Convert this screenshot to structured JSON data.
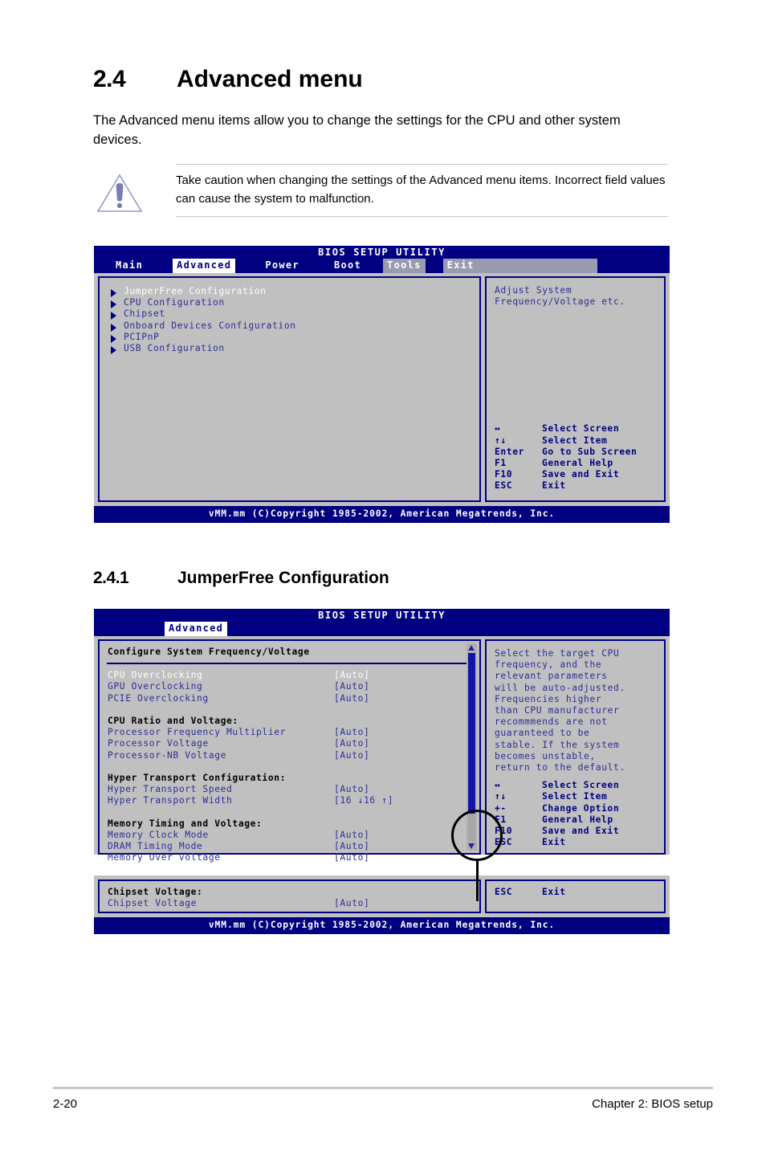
{
  "section_24": {
    "number": "2.4",
    "title": "Advanced menu",
    "paragraph": "The Advanced menu items allow you to change the settings for the CPU and other system devices."
  },
  "caution": {
    "icon": "warning-triangle-icon",
    "text": "Take caution when changing the settings of the Advanced menu items. Incorrect field values can cause the system to malfunction."
  },
  "bios_screen_1": {
    "title": "BIOS SETUP UTILITY",
    "menu": [
      {
        "label": "Main",
        "state": "normal"
      },
      {
        "label": "Advanced",
        "state": "active"
      },
      {
        "label": "Power",
        "state": "normal"
      },
      {
        "label": "Boot",
        "state": "normal"
      },
      {
        "label": "Tools",
        "state": "dim"
      },
      {
        "label": "Exit",
        "state": "dim"
      }
    ],
    "items": [
      "JumperFree Configuration",
      "CPU Configuration",
      "Chipset",
      "Onboard Devices Configuration",
      "PCIPnP",
      "USB Configuration"
    ],
    "help": "Adjust System\nFrequency/Voltage etc.",
    "keys": [
      {
        "key": "↔",
        "desc": "Select Screen"
      },
      {
        "key": "↑↓",
        "desc": "Select Item"
      },
      {
        "key": "Enter",
        "desc": "Go to Sub Screen"
      },
      {
        "key": "F1",
        "desc": "General Help"
      },
      {
        "key": "F10",
        "desc": "Save and Exit"
      },
      {
        "key": "ESC",
        "desc": "Exit"
      }
    ],
    "footer": "vMM.mm (C)Copyright 1985-2002, American Megatrends, Inc."
  },
  "section_241": {
    "number": "2.4.1",
    "title": "JumperFree Configuration"
  },
  "bios_screen_2": {
    "title": "BIOS SETUP UTILITY",
    "menu": [
      {
        "label": "Advanced",
        "state": "active"
      }
    ],
    "subhead": "Configure System Frequency/Voltage",
    "groups": [
      {
        "header": null,
        "rows": [
          {
            "label": "CPU Overclocking",
            "value": "[Auto]",
            "style": "white"
          },
          {
            "label": "GPU Overclocking",
            "value": "[Auto]",
            "style": "blue"
          },
          {
            "label": "PCIE Overclocking",
            "value": "[Auto]",
            "style": "blue"
          }
        ]
      },
      {
        "header": "CPU Ratio and Voltage:",
        "rows": [
          {
            "label": "Processor Frequency Multiplier",
            "value": "[Auto]",
            "style": "blue"
          },
          {
            "label": "Processor Voltage",
            "value": "[Auto]",
            "style": "blue"
          },
          {
            "label": "Processor-NB Voltage",
            "value": "[Auto]",
            "style": "blue"
          }
        ]
      },
      {
        "header": "Hyper Transport Configuration:",
        "rows": [
          {
            "label": "Hyper Transport Speed",
            "value": "[Auto]",
            "style": "blue"
          },
          {
            "label": "Hyper Transport Width",
            "value": "[16 ↓16 ↑]",
            "style": "blue"
          }
        ]
      },
      {
        "header": "Memory Timing and Voltage:",
        "rows": [
          {
            "label": "Memory Clock Mode",
            "value": "[Auto]",
            "style": "blue"
          },
          {
            "label": "DRAM Timing Mode",
            "value": "[Auto]",
            "style": "blue"
          },
          {
            "label": "Memory Over voltage",
            "value": "[Auto]",
            "style": "blue"
          }
        ]
      }
    ],
    "help": "Select the target CPU\nfrequency, and the\nrelevant parameters\nwill be auto-adjusted.\nFrequencies higher\nthan CPU manufacturer\nrecommmends are not\nguaranteed to be\nstable. If the system\nbecomes unstable,\nreturn to the default.",
    "keys": [
      {
        "key": "↔",
        "desc": "Select Screen"
      },
      {
        "key": "↑↓",
        "desc": "Select Item"
      },
      {
        "key": "+-",
        "desc": "Change Option"
      },
      {
        "key": "F1",
        "desc": "General Help"
      },
      {
        "key": "F10",
        "desc": "Save and Exit"
      },
      {
        "key": "ESC",
        "desc": "Exit"
      }
    ],
    "scrollbar": {
      "up_icon": "scroll-up-arrow-icon",
      "down_icon": "scroll-down-arrow-icon"
    },
    "lower_panel": {
      "header": "Chipset Voltage:",
      "rows": [
        {
          "label": "Chipset Voltage",
          "value": "[Auto]",
          "style": "blue"
        }
      ],
      "keys": [
        {
          "key": "ESC",
          "desc": "Exit"
        }
      ]
    },
    "footer": "vMM.mm (C)Copyright 1985-2002, American Megatrends, Inc."
  },
  "page_footer": {
    "left": "2-20",
    "right": "Chapter 2: BIOS setup"
  },
  "colors": {
    "bios_navy": "#000080",
    "bios_gray": "#c0c0c0",
    "bios_blue_text": "#2d2d96",
    "scroll_thumb": "#1414a8"
  }
}
